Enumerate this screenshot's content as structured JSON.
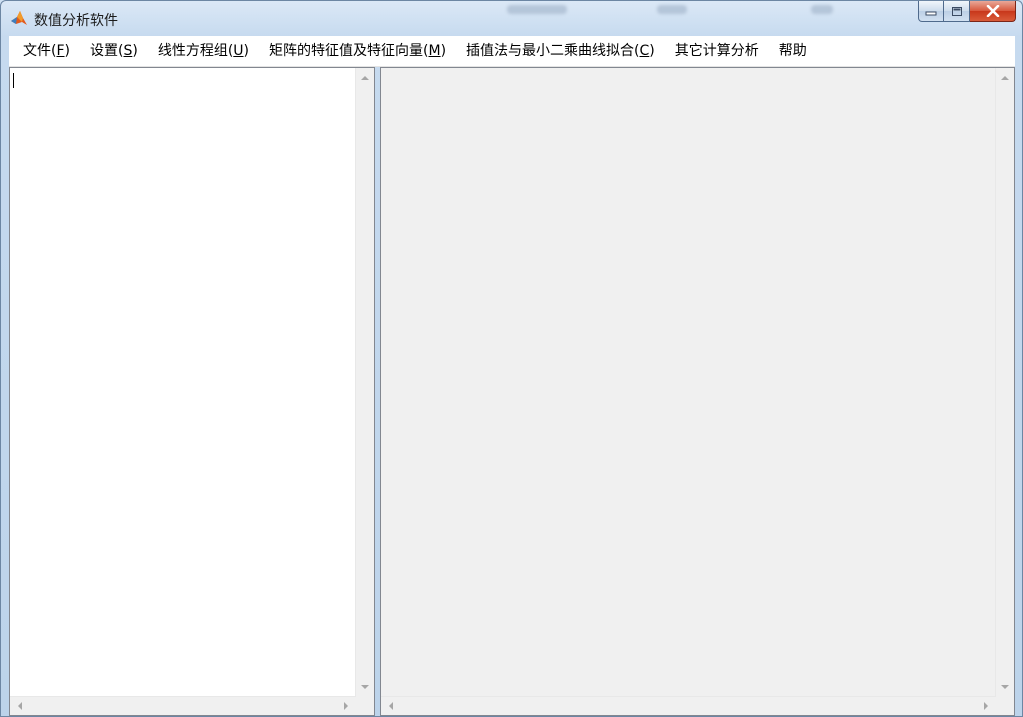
{
  "window": {
    "title": "数值分析软件",
    "icon": "matlab-icon"
  },
  "menu": [
    {
      "id": "file",
      "text": "文件(",
      "key": "F",
      "after": ")"
    },
    {
      "id": "settings",
      "text": "设置(",
      "key": "S",
      "after": ")"
    },
    {
      "id": "linear-equations",
      "text": "线性方程组(",
      "key": "U",
      "after": ")"
    },
    {
      "id": "eigen",
      "text": "矩阵的特征值及特征向量(",
      "key": "M",
      "after": ")"
    },
    {
      "id": "interpolation",
      "text": "插值法与最小二乘曲线拟合(",
      "key": "C",
      "after": ")"
    },
    {
      "id": "other",
      "text": "其它计算分析",
      "key": "",
      "after": ""
    },
    {
      "id": "help",
      "text": "帮助",
      "key": "",
      "after": ""
    }
  ],
  "editor": {
    "value": ""
  },
  "colors": {
    "titlebar": "#c6daef",
    "close_button": "#c8371b",
    "editor_bg": "#ffffff",
    "output_bg": "#f0f0f0"
  }
}
